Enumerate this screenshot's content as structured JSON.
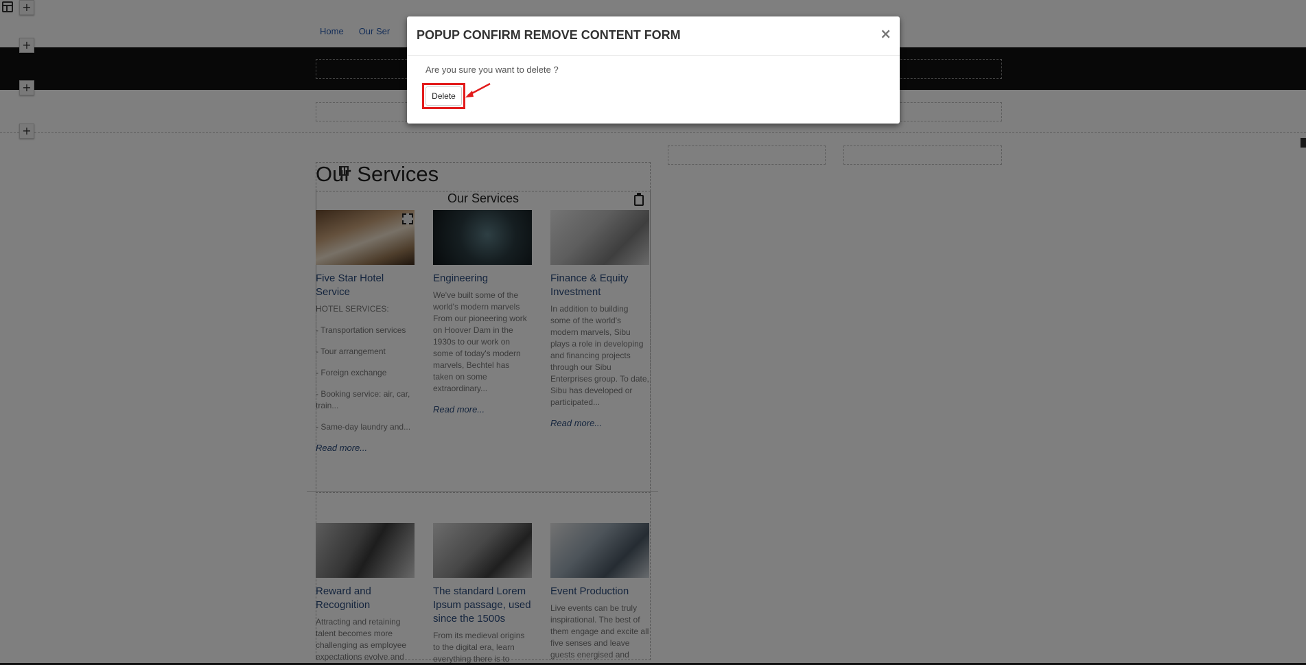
{
  "nav": {
    "items": [
      {
        "label": "Home"
      },
      {
        "label": "Our Ser"
      }
    ]
  },
  "left_tools": {
    "layout_icon": "layout-icon",
    "add_symbol": "+"
  },
  "services": {
    "title": "Our Services",
    "subtitle": "Our Services",
    "cards": [
      {
        "title": "Five Star Hotel Service",
        "paragraphs": [
          "HOTEL SERVICES:",
          "- Transportation services",
          "- Tour arrangement",
          "- Foreign exchange",
          "- Booking service: air, car, train...",
          "- Same-day laundry and..."
        ],
        "more": "Read more..."
      },
      {
        "title": "Engineering",
        "paragraphs": [
          "We've built some of the world's modern marvels From our pioneering work on Hoover Dam in the 1930s to our work on some of today's modern marvels, Bechtel has taken on some extraordinary..."
        ],
        "more": "Read more..."
      },
      {
        "title": "Finance & Equity Investment",
        "paragraphs": [
          "In addition to building some of the world's modern marvels, Sibu plays a role in developing and financing projects through our Sibu Enterprises group. To date, Sibu has developed or participated..."
        ],
        "more": "Read more..."
      },
      {
        "title": "Reward and Recognition",
        "paragraphs": [
          "Attracting and retaining talent becomes more challenging as employee expectations evolve and"
        ],
        "more": ""
      },
      {
        "title": "The standard Lorem Ipsum passage, used since the 1500s",
        "paragraphs": [
          "From its medieval origins to the digital era, learn everything there is to"
        ],
        "more": ""
      },
      {
        "title": "Event Production",
        "paragraphs": [
          "Live events can be truly inspirational. The best of them engage and excite all five senses and leave guests energised and"
        ],
        "more": ""
      }
    ]
  },
  "modal": {
    "title": "POPUP CONFIRM REMOVE CONTENT FORM",
    "close_symbol": "×",
    "message": "Are you sure you want to delete ?",
    "delete_label": "Delete"
  },
  "colors": {
    "overlay": "rgba(0,0,0,0.5)",
    "highlight": "#e21b1b",
    "link": "#2a4b7c"
  }
}
